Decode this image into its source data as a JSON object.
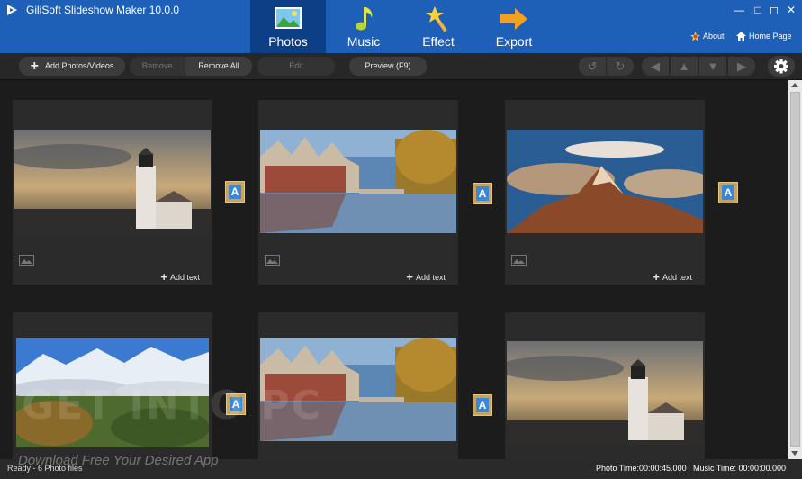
{
  "app": {
    "title": "GiliSoft Slideshow Maker 10.0.0"
  },
  "nav": [
    {
      "label": "Photos",
      "icon": "photos-icon",
      "active": true
    },
    {
      "label": "Music",
      "icon": "music-note-icon",
      "active": false
    },
    {
      "label": "Effect",
      "icon": "magic-wand-icon",
      "active": false
    },
    {
      "label": "Export",
      "icon": "export-arrow-icon",
      "active": false
    }
  ],
  "links": {
    "about": "About",
    "home": "Home Page"
  },
  "toolbar": {
    "add": "Add Photos/Videos",
    "remove": "Remove",
    "remove_all": "Remove All",
    "edit": "Edit",
    "preview": "Preview (F9)"
  },
  "cards": [
    {
      "add_text": "Add text",
      "scene": "lighthouse"
    },
    {
      "add_text": "Add text",
      "scene": "canal"
    },
    {
      "add_text": "Add text",
      "scene": "mountain"
    },
    {
      "add_text": "",
      "scene": "valley"
    },
    {
      "add_text": "",
      "scene": "canal"
    },
    {
      "add_text": "",
      "scene": "lighthouse"
    }
  ],
  "transition_label": "A",
  "watermark": {
    "big": "GET INTO PC",
    "small": "Download Free Your Desired App"
  },
  "status": {
    "text": "Ready - 6 Photo files",
    "photo_time": "Photo Time:00:00:45.000",
    "music_time": "Music Time:  00:00:00.000"
  },
  "colors": {
    "titlebar": "#1e5fb8",
    "active_tab": "#0d3f86",
    "workspace": "#1c1c1c"
  }
}
